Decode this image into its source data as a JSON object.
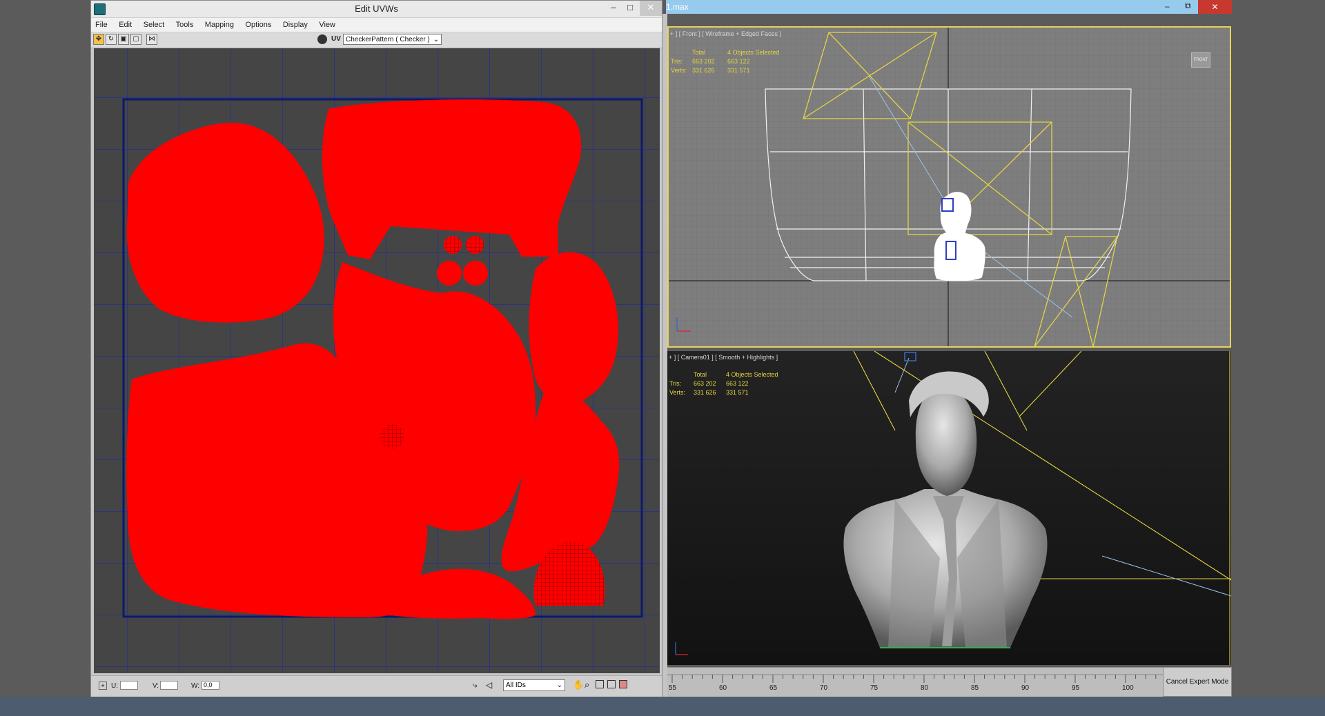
{
  "uvw_window": {
    "title": "Edit UVWs",
    "win_minimize": "–",
    "win_maximize": "□",
    "win_close": "✕",
    "menu": [
      "File",
      "Edit",
      "Select",
      "Tools",
      "Mapping",
      "Options",
      "Display",
      "View"
    ],
    "uv_label": "UV",
    "texture_dropdown": "CheckerPattern  ( Checker )",
    "status": {
      "u_label": "U:",
      "v_label": "V:",
      "w_label": "W:",
      "u_value": "",
      "v_value": "",
      "w_value": "0,0",
      "id_dropdown": "All IDs"
    }
  },
  "max_window": {
    "title": "1.max",
    "win_minimize": "–",
    "win_restore": "⧉",
    "win_close": "✕"
  },
  "viewport_front": {
    "label": "+ ] [ Front ] [ Wireframe + Edged Faces ]",
    "stats": {
      "header_total": "Total",
      "header_selected": "4 Objects Selected",
      "tris_label": "Tris:",
      "tris_total": "663 202",
      "tris_selected": "663 122",
      "verts_label": "Verts:",
      "verts_total": "331 626",
      "verts_selected": "331 571"
    },
    "viewcube_label": "FRONT"
  },
  "viewport_camera": {
    "label": "+ ] [ Camera01 ] [ Smooth + Highlights ]",
    "stats": {
      "header_total": "Total",
      "header_selected": "4 Objects Selected",
      "tris_label": "Tris:",
      "tris_total": "663 202",
      "tris_selected": "663 122",
      "verts_label": "Verts:",
      "verts_total": "331 626",
      "verts_selected": "331 571"
    }
  },
  "timeline": {
    "ticks": [
      "55",
      "60",
      "65",
      "70",
      "75",
      "80",
      "85",
      "90",
      "95",
      "100"
    ]
  },
  "expert_button": "Cancel Expert Mode",
  "colors": {
    "uv_island": "#ff0000",
    "grid_line": "#1d2aa8",
    "selection_yellow": "#e8d25a",
    "titlebar_blue": "#97cbee"
  }
}
